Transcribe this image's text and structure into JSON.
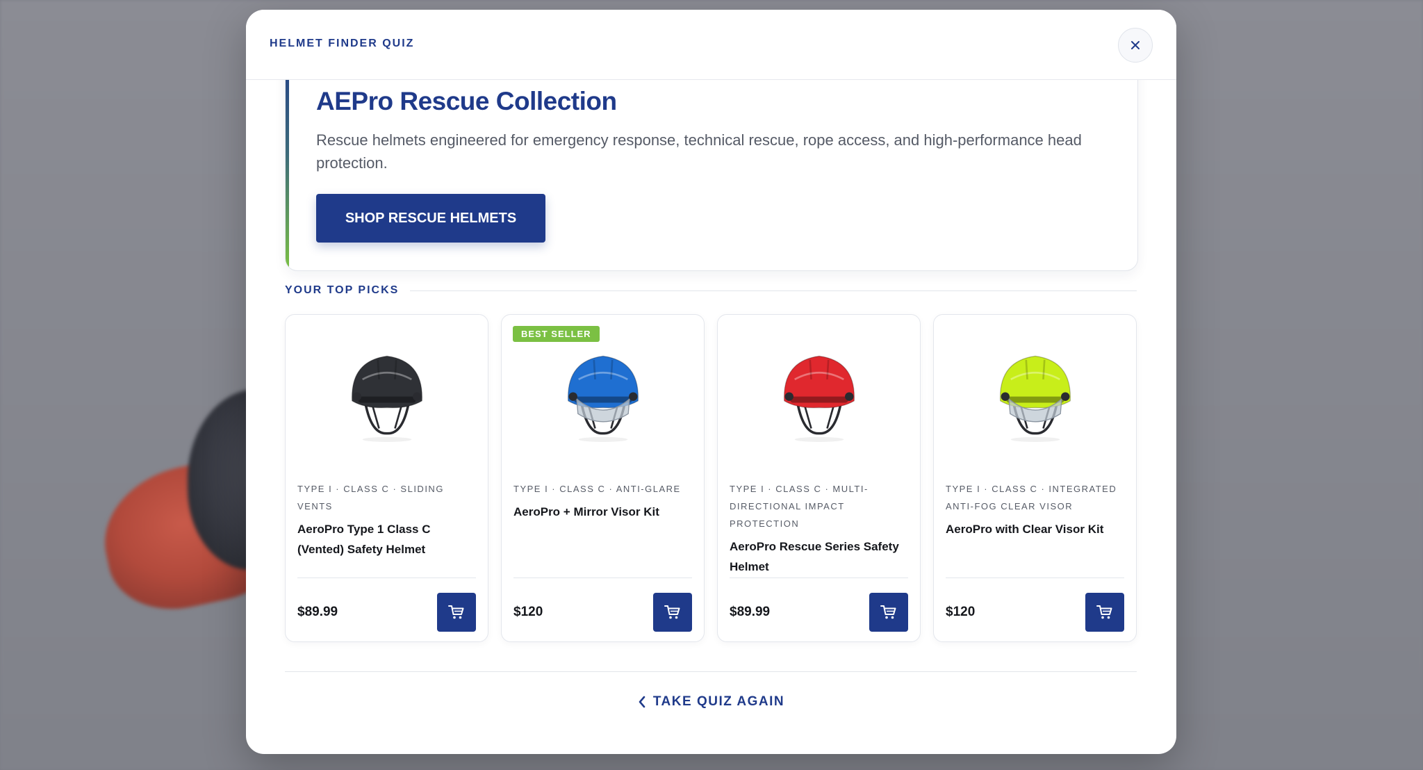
{
  "background": {
    "faint_text": ""
  },
  "modal": {
    "title": "HELMET FINDER QUIZ",
    "close_icon": "×"
  },
  "collection": {
    "title": "AEPro Rescue Collection",
    "description": "Rescue helmets engineered for emergency response, technical rescue, rope access, and high-performance head protection.",
    "shop_label": "SHOP RESCUE HELMETS"
  },
  "top_picks": {
    "heading": "YOUR TOP PICKS",
    "products": [
      {
        "badge": "",
        "meta": "TYPE I · CLASS C · SLIDING VENTS",
        "name": "AeroPro Type 1 Class C (Vented) Safety Helmet",
        "price": "$89.99",
        "helmet_color": "#2f3136",
        "visor": false
      },
      {
        "badge": "BEST SELLER",
        "meta": "TYPE I · CLASS C · ANTI-GLARE",
        "name": "AeroPro + Mirror Visor Kit",
        "price": "$120",
        "helmet_color": "#1f6fd1",
        "visor": true
      },
      {
        "badge": "",
        "meta": "TYPE I · CLASS C · MULTI-DIRECTIONAL IMPACT PROTECTION",
        "name": "AeroPro Rescue Series Safety Helmet",
        "price": "$89.99",
        "helmet_color": "#e0282e",
        "visor": false
      },
      {
        "badge": "",
        "meta": "TYPE I · CLASS C · INTEGRATED ANTI-FOG CLEAR VISOR",
        "name": "AeroPro with Clear Visor Kit",
        "price": "$120",
        "helmet_color": "#c8ee1a",
        "visor": true
      }
    ]
  },
  "footer": {
    "take_quiz_again": "TAKE QUIZ AGAIN"
  },
  "icons": {
    "close": "close-icon",
    "cart": "cart-icon",
    "chevron": "chevron-left-icon"
  },
  "colors": {
    "brand": "#1f3a8a",
    "accent_green": "#7bc043"
  }
}
